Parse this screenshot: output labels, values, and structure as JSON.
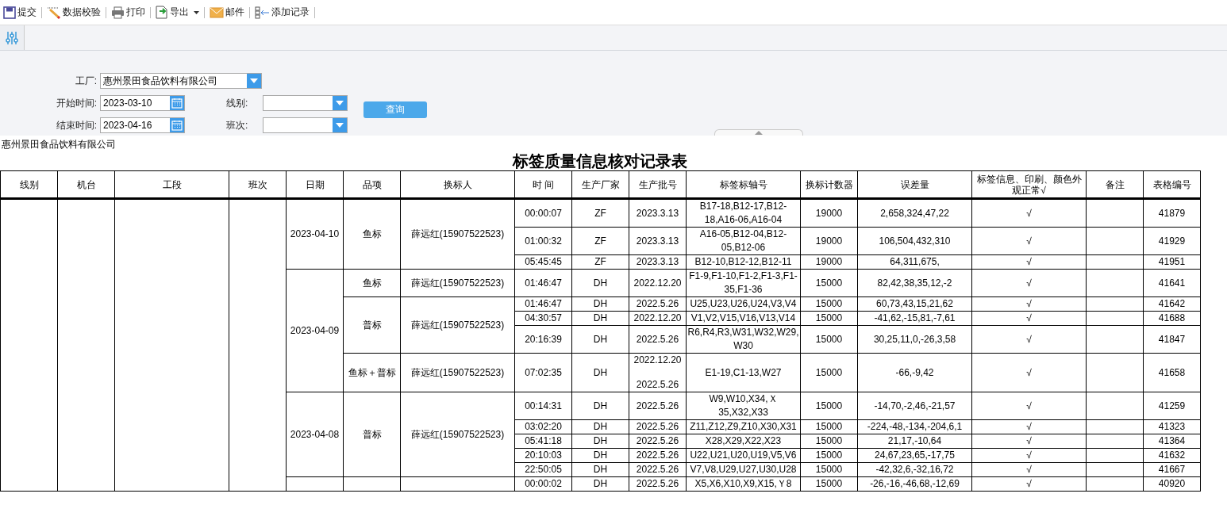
{
  "toolbar": [
    {
      "kind": "save",
      "label": "提交"
    },
    {
      "kind": "validate",
      "label": "数据校验"
    },
    {
      "kind": "print",
      "label": "打印"
    },
    {
      "kind": "export",
      "label": "导出",
      "dropdown": true
    },
    {
      "kind": "mail",
      "label": "邮件"
    },
    {
      "kind": "add",
      "label": "添加记录"
    }
  ],
  "tabs": [
    {
      "kind": "filter",
      "selected": true
    }
  ],
  "filters": {
    "factory": {
      "label": "工厂:",
      "value": "惠州景田食品饮料有限公司"
    },
    "start": {
      "label": "开始时间:",
      "value": "2023-03-10"
    },
    "end": {
      "label": "结束时间:",
      "value": "2023-04-16"
    },
    "line": {
      "label": "线别:"
    },
    "shift": {
      "label": "班次:"
    },
    "query_button": "查询"
  },
  "company": "惠州景田食品饮料有限公司",
  "report_title": "标签质量信息核对记录表",
  "table": {
    "columns": [
      "线别",
      "机台",
      "工段",
      "班次",
      "日期",
      "品项",
      "换标人",
      "时 间",
      "生产厂家",
      "生产批号",
      "标签标轴号",
      "换标计数器",
      "误差量",
      "标签信息、印刷、颜色外观正常√",
      "备注",
      "表格编号"
    ],
    "groups": [
      {
        "date": "2023-04-10",
        "items": [
          {
            "item": "鱼标",
            "person": "薛远红(15907522523)",
            "records": [
              {
                "time": "00:00:07",
                "maker": "ZF",
                "batch": [
                  "2023.3.13"
                ],
                "reels": "B17-18,B12-17,B12-18,A16-06,A16-04",
                "counter": "19000",
                "error": "2,658,324,47,22",
                "check": "√",
                "form_no": "41879"
              },
              {
                "time": "01:00:32",
                "maker": "ZF",
                "batch": [
                  "2023.3.13"
                ],
                "reels": "A16-05,B12-04,B12-05,B12-06",
                "counter": "19000",
                "error": "106,504,432,310",
                "check": "√",
                "form_no": "41929"
              },
              {
                "time": "05:45:45",
                "maker": "ZF",
                "batch": [
                  "2023.3.13"
                ],
                "reels": "B12-10,B12-12,B12-11",
                "counter": "19000",
                "error": "64,311,675,",
                "check": "√",
                "form_no": "41951"
              }
            ]
          }
        ]
      },
      {
        "date": "2023-04-09",
        "items": [
          {
            "item": "鱼标",
            "person": "薛远红(15907522523)",
            "records": [
              {
                "time": "01:46:47",
                "maker": "DH",
                "batch": [
                  "2022.12.20"
                ],
                "reels": "F1-9,F1-10,F1-2,F1-3,F1-35,F1-36",
                "counter": "15000",
                "error": "82,42,38,35,12,-2",
                "check": "√",
                "form_no": "41641"
              }
            ]
          },
          {
            "item": "普标",
            "person": "薛远红(15907522523)",
            "records": [
              {
                "time": "01:46:47",
                "maker": "DH",
                "batch": [
                  "2022.5.26"
                ],
                "reels": "U25,U23,U26,U24,V3,V4",
                "counter": "15000",
                "error": "60,73,43,15,21,62",
                "check": "√",
                "form_no": "41642"
              },
              {
                "time": "04:30:57",
                "maker": "DH",
                "batch": [
                  "2022.12.20"
                ],
                "reels": "V1,V2,V15,V16,V13,V14",
                "counter": "15000",
                "error": "-41,62,-15,81,-7,61",
                "check": "√",
                "form_no": "41688"
              },
              {
                "time": "20:16:39",
                "maker": "DH",
                "batch": [
                  "2022.5.26"
                ],
                "reels": "R6,R4,R3,W31,W32,W29,W30",
                "counter": "15000",
                "error": "30,25,11,0,-26,3,58",
                "check": "√",
                "form_no": "41847"
              }
            ]
          },
          {
            "item": "鱼标＋普标",
            "person": "薛远红(15907522523)",
            "records": [
              {
                "time": "07:02:35",
                "maker": "DH",
                "batch": [
                  "2022.12.20",
                  "2022.5.26"
                ],
                "reels": "E1-19,C1-13,W27",
                "counter": "15000",
                "error": "-66,-9,42",
                "check": "√",
                "form_no": "41658"
              }
            ]
          }
        ]
      },
      {
        "date": "2023-04-08",
        "items": [
          {
            "item": "普标",
            "person": "薛远红(15907522523)",
            "records": [
              {
                "time": "00:14:31",
                "maker": "DH",
                "batch": [
                  "2022.5.26"
                ],
                "reels": "W9,W10,X34,Ｘ35,X32,X33",
                "counter": "15000",
                "error": "-14,70,-2,46,-21,57",
                "check": "√",
                "form_no": "41259"
              },
              {
                "time": "03:02:20",
                "maker": "DH",
                "batch": [
                  "2022.5.26"
                ],
                "reels": "Z11,Z12,Z9,Z10,X30,X31",
                "counter": "15000",
                "error": "-224,-48,-134,-204,6,1",
                "check": "√",
                "form_no": "41323"
              },
              {
                "time": "05:41:18",
                "maker": "DH",
                "batch": [
                  "2022.5.26"
                ],
                "reels": "X28,X29,X22,X23",
                "counter": "15000",
                "error": "21,17,-10,64",
                "check": "√",
                "form_no": "41364"
              },
              {
                "time": "20:10:03",
                "maker": "DH",
                "batch": [
                  "2022.5.26"
                ],
                "reels": "U22,U21,U20,U19,V5,V6",
                "counter": "15000",
                "error": "24,67,23,65,-17,75",
                "check": "√",
                "form_no": "41632"
              },
              {
                "time": "22:50:05",
                "maker": "DH",
                "batch": [
                  "2022.5.26"
                ],
                "reels": "V7,V8,U29,U27,U30,U28",
                "counter": "15000",
                "error": "-42,32,6,-32,16,72",
                "check": "√",
                "form_no": "41667"
              }
            ]
          }
        ]
      },
      {
        "items": [
          {
            "records": [
              {
                "time": "00:00:02",
                "maker": "DH",
                "batch": [
                  "2022.5.26"
                ],
                "reels": "X5,X6,X10,X9,X15,Ｙ8",
                "counter": "15000",
                "error": "-26,-16,-46,68,-12,69",
                "check": "√",
                "form_no": "40920"
              }
            ]
          }
        ]
      }
    ]
  }
}
